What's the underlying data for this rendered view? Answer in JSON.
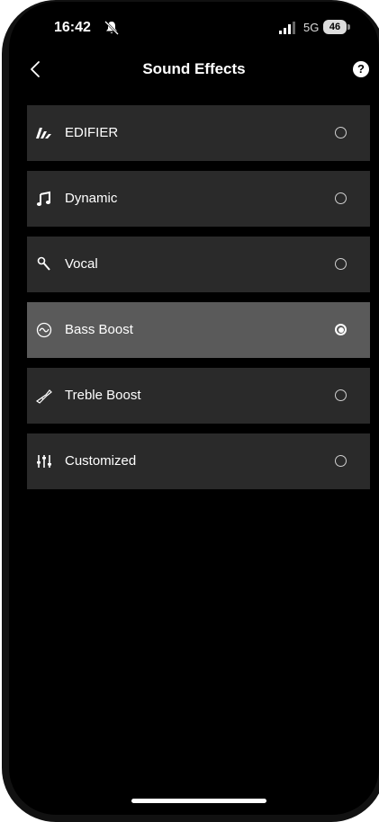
{
  "status_bar": {
    "time": "16:42",
    "network": "5G",
    "battery": "46"
  },
  "nav": {
    "title": "Sound Effects",
    "help": "?"
  },
  "options": [
    {
      "label": "EDIFIER",
      "icon": "edifier-logo-icon",
      "selected": false
    },
    {
      "label": "Dynamic",
      "icon": "music-note-icon",
      "selected": false
    },
    {
      "label": "Vocal",
      "icon": "microphone-icon",
      "selected": false
    },
    {
      "label": "Bass Boost",
      "icon": "wave-circle-icon",
      "selected": true
    },
    {
      "label": "Treble Boost",
      "icon": "trumpet-icon",
      "selected": false
    },
    {
      "label": "Customized",
      "icon": "equalizer-sliders-icon",
      "selected": false
    }
  ],
  "colors": {
    "background": "#000000",
    "row": "#2a2a2a",
    "row_selected": "#5a5a5a",
    "text": "#ffffff"
  }
}
